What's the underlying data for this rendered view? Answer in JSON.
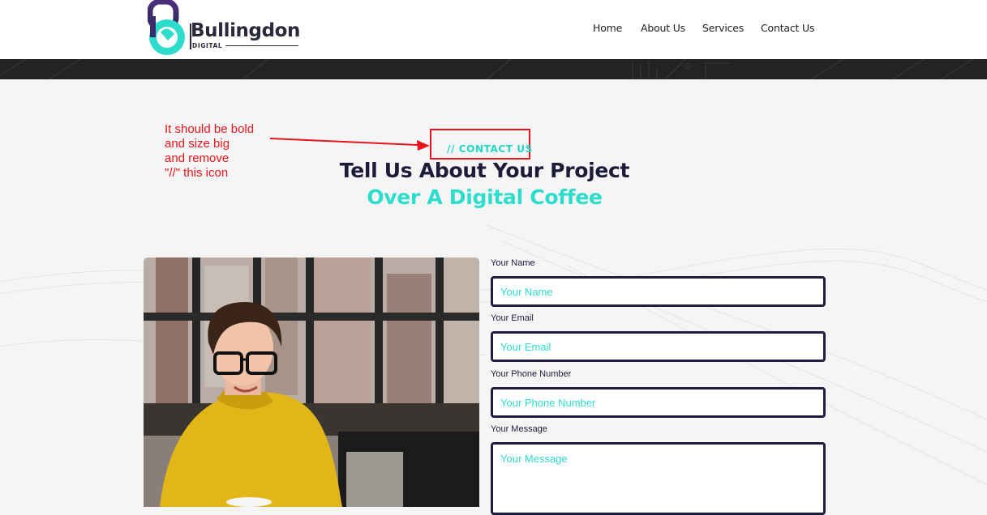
{
  "brand": {
    "name": "Bullingdon",
    "tagline": "DIGITAL"
  },
  "nav": {
    "items": [
      "Home",
      "About Us",
      "Services",
      "Contact Us"
    ]
  },
  "annotation": {
    "lines": [
      "It should be bold",
      "and size big",
      "and remove",
      "\"//\" this icon"
    ],
    "color": "#e8141c"
  },
  "hero": {
    "eyebrow": "// CONTACT US",
    "title": "Tell Us About Your Project",
    "subtitle": "Over A Digital Coffee"
  },
  "form": {
    "name": {
      "label": "Your Name",
      "placeholder": "Your Name"
    },
    "email": {
      "label": "Your Email",
      "placeholder": "Your Email"
    },
    "phone": {
      "label": "Your Phone Number",
      "placeholder": "Your Phone Number"
    },
    "message": {
      "label": "Your Message",
      "placeholder": "Your Message"
    }
  },
  "colors": {
    "accent": "#2ddccb",
    "dark": "#1c1b3a",
    "band": "#232325",
    "field_border": "#1f1d3f"
  }
}
